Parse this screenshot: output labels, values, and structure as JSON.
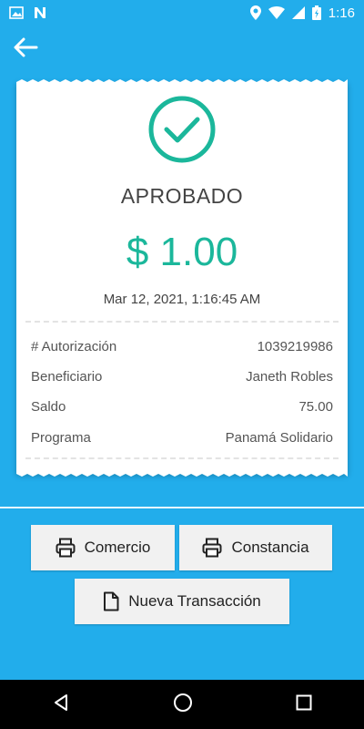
{
  "status_bar": {
    "time": "1:16",
    "left_icons": [
      "image-icon",
      "n-app-icon"
    ],
    "right_icons": [
      "location-icon",
      "wifi-icon",
      "signal-icon",
      "battery-icon"
    ]
  },
  "receipt": {
    "status": "APROBADO",
    "amount": "$ 1.00",
    "datetime": "Mar 12, 2021, 1:16:45 AM",
    "details": [
      {
        "label": "# Autorización",
        "value": "1039219986"
      },
      {
        "label": "Beneficiario",
        "value": "Janeth Robles"
      },
      {
        "label": "Saldo",
        "value": "75.00"
      },
      {
        "label": "Programa",
        "value": "Panamá Solidario"
      }
    ]
  },
  "actions": {
    "comercio": "Comercio",
    "constancia": "Constancia",
    "nueva": "Nueva Transacción"
  },
  "colors": {
    "background": "#22adeb",
    "accent": "#1bb79b"
  }
}
